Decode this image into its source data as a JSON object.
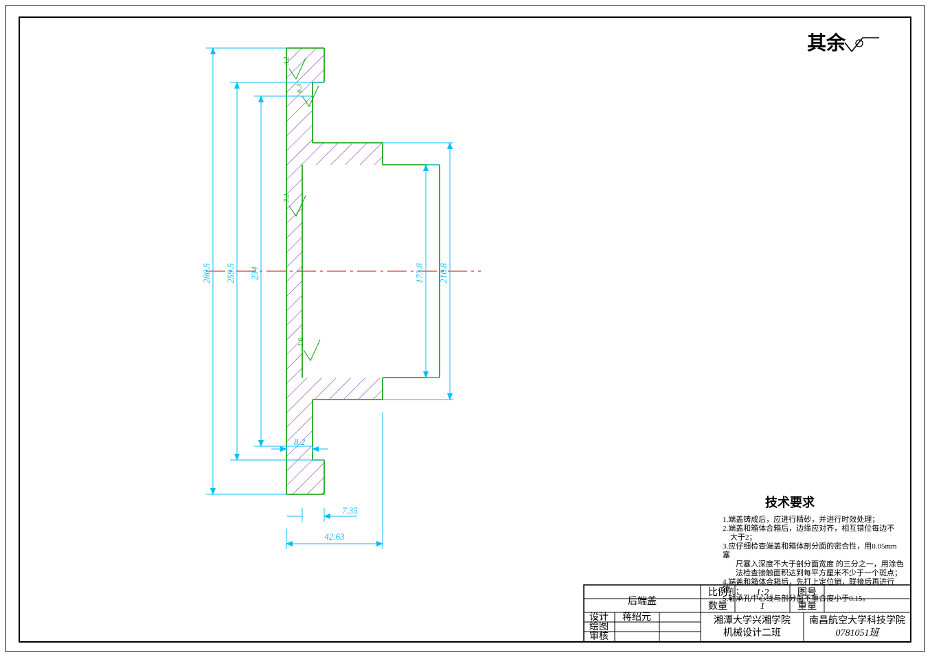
{
  "top_right": {
    "label": "其余"
  },
  "dimensions": {
    "d1": "280.5",
    "d2": "259.5",
    "d3": "234",
    "d4": "173.8",
    "d5": "210.8",
    "w1": "8.2",
    "w2": "7.35",
    "w3": "42.63"
  },
  "surface_finish": {
    "s1": "3.2",
    "s2": "6.3",
    "s3": "3.2",
    "s4": "1.6"
  },
  "tech_req": {
    "title": "技术要求",
    "n1": "1.端盖铸成后，应进行精砂，并进行时效处理；",
    "n2": "2.端盖和箱体合箱后，边缘应对齐，相互错位每边不",
    "n2b": "　大于2；",
    "n3": "3.应仔细检查端盖和箱体剖分面的密合性，用0.05mm",
    "n3b": "塞",
    "n3c": "　尺塞入深度不大于剖分面宽度 的三分之一，用涂色",
    "n3d": "　法检查接触面积达到每平方厘米不少于一个斑点；",
    "n4": "4.端盖和箱体合箱后，先打上定位销，联接后再进行",
    "n4b": "镗",
    "n4c": "孔；",
    "n5": "5.轴承孔中心线与剖分面不重合度小于0.15。"
  },
  "title_block": {
    "part_name": "后端盖",
    "scale_label": "比例",
    "scale_value": "1:2",
    "drawing_no_label": "图号",
    "qty_label": "数量",
    "qty_value": "1",
    "weight_label": "重量",
    "designed_label": "设计",
    "designed_value": "蒋绍元",
    "drawn_label": "绘图",
    "checked_label": "审核",
    "school1_line1": "湘潭大学兴湘学院",
    "school1_line2": "机械设计二班",
    "school2_line1": "南昌航空大学科技学院",
    "school2_line2": "0781051班"
  }
}
